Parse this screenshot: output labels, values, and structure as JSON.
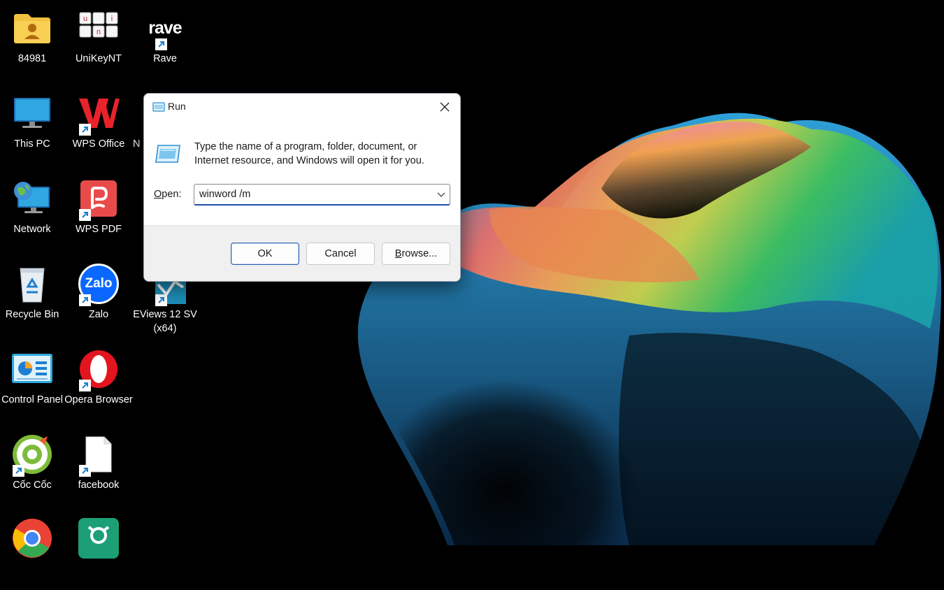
{
  "desktop": {
    "icons": [
      {
        "name": "84981",
        "icon": "user-folder-icon",
        "shortcut": false
      },
      {
        "name": "UniKeyNT",
        "icon": "unikey-icon",
        "shortcut": false
      },
      {
        "name": "Rave",
        "icon": "rave-icon",
        "shortcut": true,
        "logo_text": "rave"
      },
      {
        "name": "This PC",
        "icon": "monitor-icon",
        "shortcut": false
      },
      {
        "name": "WPS Office",
        "icon": "wps-office-icon",
        "shortcut": true
      },
      {
        "name": "Network",
        "icon": "network-globe-icon",
        "shortcut": false
      },
      {
        "name": "WPS PDF",
        "icon": "wps-pdf-icon",
        "shortcut": true
      },
      {
        "name": "Recycle Bin",
        "icon": "recycle-bin-icon",
        "shortcut": false
      },
      {
        "name": "Zalo",
        "icon": "zalo-icon",
        "shortcut": true,
        "logo_text": "Zalo"
      },
      {
        "name": "EViews 12 SV (x64)",
        "icon": "eviews-icon",
        "shortcut": true
      },
      {
        "name": "Control Panel",
        "icon": "control-panel-icon",
        "shortcut": false
      },
      {
        "name": "Opera Browser",
        "icon": "opera-icon",
        "shortcut": true
      },
      {
        "name": "Cốc Cốc",
        "icon": "coccoc-icon",
        "shortcut": true
      },
      {
        "name": "facebook",
        "icon": "blank-file-icon",
        "shortcut": true
      },
      {
        "name": "N",
        "icon": "partial-app-icon",
        "shortcut": false
      },
      {
        "name": "",
        "icon": "chrome-icon",
        "shortcut": false
      },
      {
        "name": "",
        "icon": "green-app-icon",
        "shortcut": false
      }
    ]
  },
  "run_dialog": {
    "title": "Run",
    "description": "Type the name of a program, folder, document, or Internet resource, and Windows will open it for you.",
    "open_label_accel": "O",
    "open_label_rest": "pen:",
    "input_value": "winword /m",
    "buttons": {
      "ok": "OK",
      "cancel": "Cancel",
      "browse_accel": "B",
      "browse_rest": "rowse..."
    }
  },
  "colors": {
    "accent": "#1e4fa8",
    "dialog_bg": "#ffffff",
    "footer_bg": "#f0f0f0",
    "desktop_bg": "#000000"
  }
}
